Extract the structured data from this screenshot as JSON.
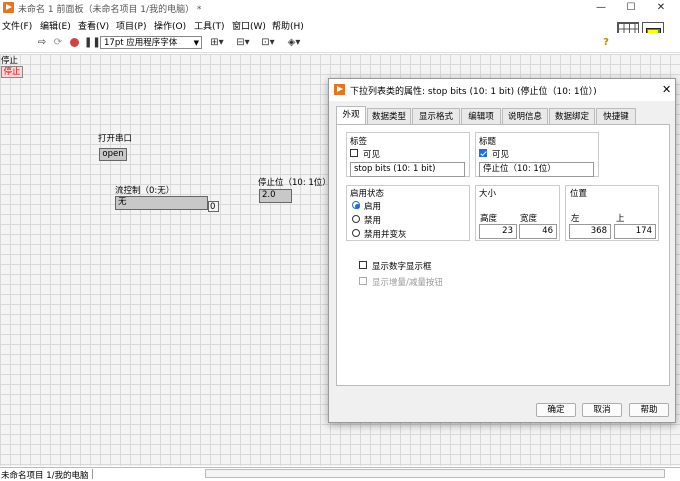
{
  "window": {
    "title": "未命名 1 前面板（未命名项目 1/我的电脑） *",
    "minimize": "—",
    "maximize": "☐",
    "close": "✕"
  },
  "menu": [
    "文件(F)",
    "编辑(E)",
    "查看(V)",
    "项目(P)",
    "操作(O)",
    "工具(T)",
    "窗口(W)",
    "帮助(H)"
  ],
  "toolbar": {
    "font": "17pt 应用程序字体",
    "help": "?"
  },
  "front_panel": {
    "stop_label": "停止",
    "stop_button": "停止",
    "open_port_label": "打开串口",
    "open_button": "open",
    "flow_label": "流控制（0:无）",
    "flow_value": "无",
    "flow_index": "0",
    "stopbits_label": "停止位（10: 1位）",
    "stopbits_value": "2.0"
  },
  "status_bar": "未命名项目 1/我的电脑",
  "dialog": {
    "title": "下拉列表类的属性: stop bits (10: 1 bit) (停止位（10: 1位）)",
    "tabs": [
      "外观",
      "数据类型",
      "显示格式",
      "编辑项",
      "说明信息",
      "数据绑定",
      "快捷键"
    ],
    "label_group": {
      "title": "标签",
      "visible": "可见",
      "visible_checked": false,
      "text": "stop bits (10: 1 bit)"
    },
    "caption_group": {
      "title": "标题",
      "visible": "可见",
      "visible_checked": true,
      "text": "停止位（10: 1位）"
    },
    "enable_group": {
      "title": "启用状态",
      "options": [
        "启用",
        "禁用",
        "禁用并变灰"
      ],
      "selected": "启用"
    },
    "size_group": {
      "title": "大小",
      "height_label": "高度",
      "width_label": "宽度",
      "height": "23",
      "width": "46"
    },
    "position_group": {
      "title": "位置",
      "left_label": "左",
      "top_label": "上",
      "left": "368",
      "top": "174"
    },
    "show_digital_display": "显示数字显示框",
    "show_increment": "显示增量/减量按钮",
    "buttons": {
      "ok": "确定",
      "cancel": "取消",
      "help": "帮助"
    }
  },
  "colors": {
    "accent": "#1e6fd9",
    "labview_orange": "#e8741c",
    "stop_red": "#ff4d4d"
  }
}
